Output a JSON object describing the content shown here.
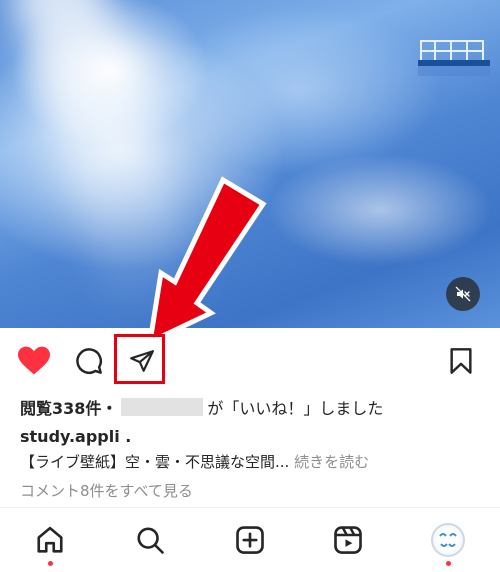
{
  "post": {
    "views_label": "閲覧338件",
    "separator": "・",
    "liked_suffix": "が「いいね！」しました",
    "username": "study.appli .",
    "caption_text": "【ライブ壁紙】空・雲・不思議な空間...",
    "caption_more": "続きを読む",
    "view_comments": "コメント8件をすべて見る"
  },
  "icons": {
    "like": "heart-filled-icon",
    "comment": "comment-bubble-icon",
    "share": "paper-plane-icon",
    "save": "bookmark-icon",
    "mute": "speaker-muted-icon"
  },
  "bottom_nav": [
    {
      "id": "home",
      "icon": "home-icon",
      "has_dot": true
    },
    {
      "id": "search",
      "icon": "search-icon",
      "has_dot": false
    },
    {
      "id": "create",
      "icon": "plus-square-icon",
      "has_dot": false
    },
    {
      "id": "reels",
      "icon": "reels-icon",
      "has_dot": false
    },
    {
      "id": "profile",
      "icon": "avatar",
      "has_dot": true
    }
  ],
  "colors": {
    "like_red": "#ff3040",
    "annotation_red": "#e60012",
    "text_primary": "#262626",
    "text_secondary": "#8e8e8e"
  }
}
